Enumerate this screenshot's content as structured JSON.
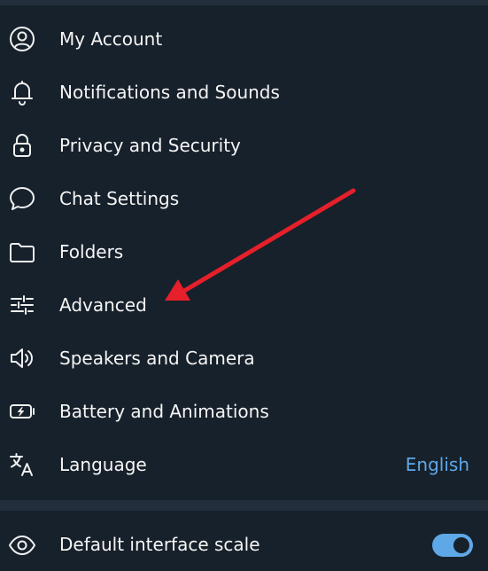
{
  "settings_menu": {
    "items": [
      {
        "label": "My Account",
        "icon": "account-circle-icon"
      },
      {
        "label": "Notifications and Sounds",
        "icon": "bell-icon"
      },
      {
        "label": "Privacy and Security",
        "icon": "lock-icon"
      },
      {
        "label": "Chat Settings",
        "icon": "chat-bubble-icon"
      },
      {
        "label": "Folders",
        "icon": "folder-icon"
      },
      {
        "label": "Advanced",
        "icon": "sliders-icon"
      },
      {
        "label": "Speakers and Camera",
        "icon": "speaker-icon"
      },
      {
        "label": "Battery and Animations",
        "icon": "battery-icon"
      },
      {
        "label": "Language",
        "icon": "translate-icon",
        "value": "English"
      }
    ]
  },
  "interface_scale": {
    "label": "Default interface scale",
    "icon": "eye-icon",
    "enabled": true
  },
  "colors": {
    "background": "#17212b",
    "divider": "#232e3c",
    "text": "#f5f5f5",
    "accent": "#5fa8e8",
    "annotation_arrow": "#e5202a"
  }
}
